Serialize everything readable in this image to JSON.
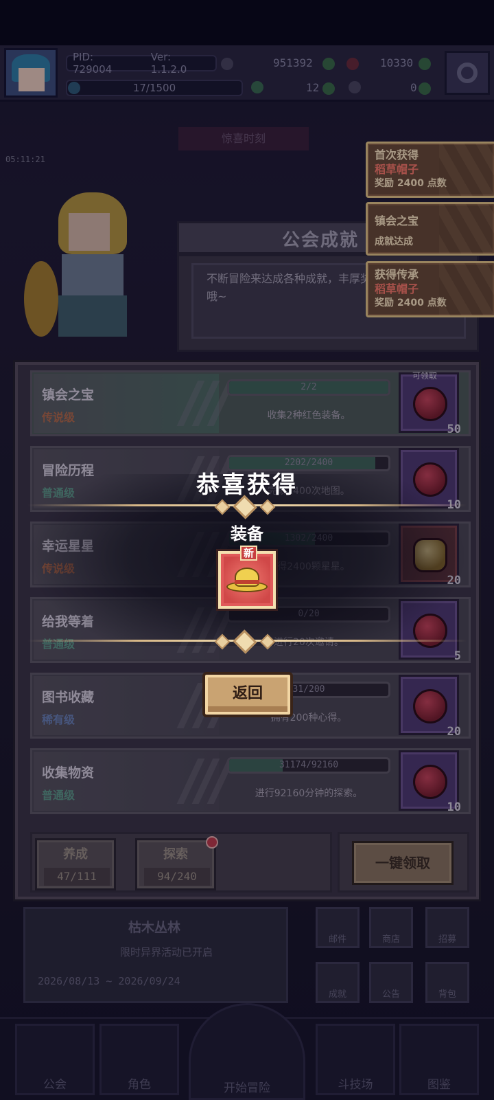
{
  "topbar": {
    "pid": "PID: 729004",
    "version": "Ver: 1.1.2.0",
    "gold": "951392",
    "gems": "10330",
    "stamina": "17/1500",
    "clovers": "12",
    "potions": "0"
  },
  "character": {
    "timer": "05:11:21"
  },
  "guild": {
    "banner_faded": "惊喜时刻",
    "title": "公会成就",
    "description": "不断冒险来达成各种成就，丰厚奖励哦~"
  },
  "toasts": [
    {
      "line1": "首次获得",
      "line2": "稻草帽子",
      "line3": "奖励 2400 点数"
    },
    {
      "line1": "镇会之宝",
      "line2": "",
      "line3": "成就达成"
    },
    {
      "line1": "获得传承",
      "line2": "稻草帽子",
      "line3": "奖励 2400 点数"
    }
  ],
  "achievements": [
    {
      "name": "镇会之宝",
      "rank": "传说级",
      "rank_color": "#b56a4a",
      "progress_text": "2/2",
      "progress": 1.0,
      "desc": "收集2种红色装备。",
      "reward_qty": "50",
      "reward_icon": "red-gem-icon",
      "claim_tag": "可领取"
    },
    {
      "name": "冒险历程",
      "rank": "普通级",
      "rank_color": "#5f9a8a",
      "progress_text": "2202/2400",
      "progress": 0.92,
      "desc": "完成2400次地图。",
      "reward_qty": "10",
      "reward_icon": "red-gem-icon",
      "claim_tag": ""
    },
    {
      "name": "幸运星星",
      "rank": "传说级",
      "rank_color": "#b56a4a",
      "progress_text": "1302/2400",
      "progress": 0.54,
      "desc": "获得2400颗星星。",
      "reward_qty": "20",
      "reward_icon": "gold-crystal-icon",
      "claim_tag": ""
    },
    {
      "name": "给我等着",
      "rank": "普通级",
      "rank_color": "#5f9a8a",
      "progress_text": "0/20",
      "progress": 0.0,
      "desc": "进行20次邀请。",
      "reward_qty": "5",
      "reward_icon": "red-gem-icon",
      "claim_tag": ""
    },
    {
      "name": "图书收藏",
      "rank": "稀有级",
      "rank_color": "#6a82b8",
      "progress_text": "31/200",
      "progress": 0.155,
      "desc": "拥有200种心得。",
      "reward_qty": "20",
      "reward_icon": "red-gem-icon",
      "claim_tag": ""
    },
    {
      "name": "收集物资",
      "rank": "普通级",
      "rank_color": "#5f9a8a",
      "progress_text": "31174/92160",
      "progress": 0.338,
      "desc": "进行92160分钟的探索。",
      "reward_qty": "10",
      "reward_icon": "red-gem-icon",
      "claim_tag": ""
    }
  ],
  "tabs": [
    {
      "label": "养成",
      "count": "47/111"
    },
    {
      "label": "探索",
      "count": "94/240"
    }
  ],
  "claim_all": "一键领取",
  "event": {
    "title": "枯木丛林",
    "subtitle": "限时异界活动已开启",
    "dates": "2026/08/13 ~ 2026/09/24"
  },
  "side_buttons": [
    "邮件",
    "商店",
    "招募",
    "成就",
    "公告",
    "背包"
  ],
  "nav": [
    "公会",
    "角色",
    "开始冒险",
    "斗技场",
    "图鉴"
  ],
  "popup": {
    "congrats": "恭喜获得",
    "category": "装备",
    "new_tag": "新",
    "item_icon": "straw-hat-icon",
    "return_label": "返回"
  },
  "colors": {
    "accent_gold": "#e8c888",
    "toast_red": "#ff7a6a",
    "bar_fill": "#40645a"
  }
}
